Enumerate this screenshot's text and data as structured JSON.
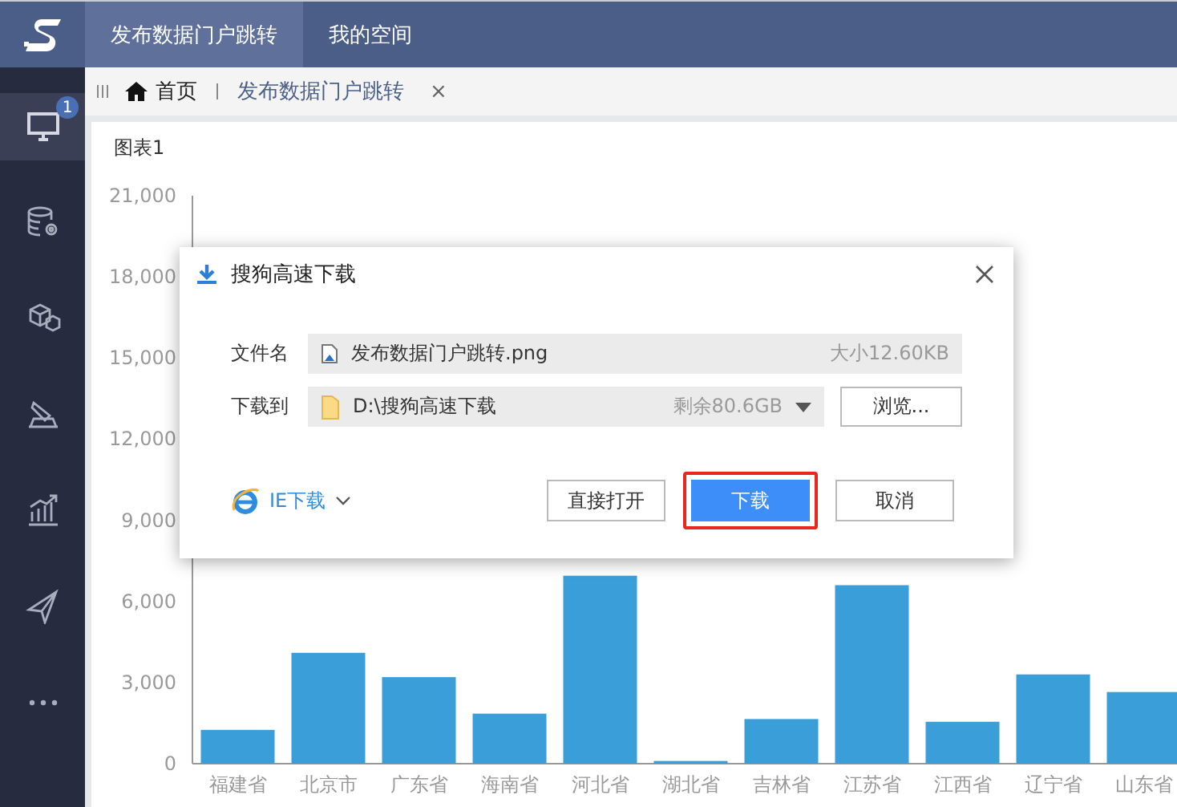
{
  "header": {
    "tabs": [
      {
        "label": "发布数据门户跳转",
        "selected": true
      },
      {
        "label": "我的空间",
        "selected": false
      }
    ]
  },
  "sidebar": {
    "items": [
      {
        "kind": "monitor",
        "selected": true,
        "badge": "1"
      },
      {
        "kind": "database",
        "selected": false
      },
      {
        "kind": "cubes",
        "selected": false
      },
      {
        "kind": "tool",
        "selected": false
      },
      {
        "kind": "chart",
        "selected": false
      },
      {
        "kind": "plane",
        "selected": false
      },
      {
        "kind": "more",
        "selected": false
      }
    ]
  },
  "breadcrumb": {
    "home": "首页",
    "tabs": [
      {
        "label": "发布数据门户跳转",
        "close": "×"
      }
    ]
  },
  "chart": {
    "title": "图表1",
    "chart_data": {
      "type": "bar",
      "categories": [
        "福建省",
        "北京市",
        "广东省",
        "海南省",
        "河北省",
        "湖北省",
        "吉林省",
        "江苏省",
        "江西省",
        "辽宁省",
        "山东省"
      ],
      "series": [
        {
          "color": "#3a9fd9",
          "values": [
            1250,
            4100,
            3200,
            1850,
            6950,
            100,
            1650,
            6600,
            1550,
            3300,
            2650
          ]
        }
      ],
      "ylim": [
        0,
        21000
      ],
      "yticks": [
        {
          "value": 0,
          "label": "0"
        },
        {
          "value": 3000,
          "label": "3,000"
        },
        {
          "value": 6000,
          "label": "6,000"
        },
        {
          "value": 9000,
          "label": "9,000"
        },
        {
          "value": 12000,
          "label": "12,000"
        },
        {
          "value": 15000,
          "label": "15,000"
        },
        {
          "value": 18000,
          "label": "18,000"
        },
        {
          "value": 21000,
          "label": "21,000"
        }
      ]
    }
  },
  "dialog": {
    "title": "搜狗高速下载",
    "file": {
      "label": "文件名",
      "value": "发布数据门户跳转.png",
      "size": "大小12.60KB"
    },
    "target": {
      "label": "下载到",
      "value": "D:\\搜狗高速下载",
      "free": "剩余80.6GB",
      "browse": "浏览..."
    },
    "ie_link": "IE下载",
    "buttons": [
      {
        "label": "直接打开",
        "kind": "secondary",
        "highlighted": false
      },
      {
        "label": "下载",
        "kind": "primary",
        "highlighted": true
      },
      {
        "label": "取消",
        "kind": "secondary",
        "highlighted": false
      }
    ]
  }
}
